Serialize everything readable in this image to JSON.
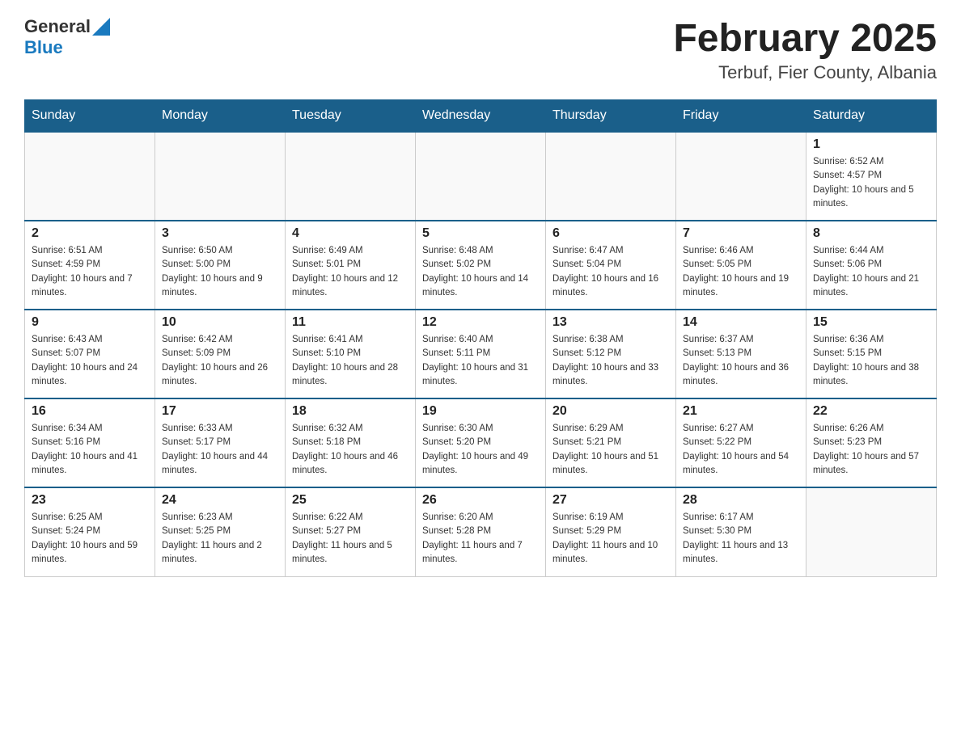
{
  "header": {
    "logo_general": "General",
    "logo_blue": "Blue",
    "month_title": "February 2025",
    "location": "Terbuf, Fier County, Albania"
  },
  "weekdays": [
    "Sunday",
    "Monday",
    "Tuesday",
    "Wednesday",
    "Thursday",
    "Friday",
    "Saturday"
  ],
  "weeks": [
    [
      {
        "day": "",
        "info": ""
      },
      {
        "day": "",
        "info": ""
      },
      {
        "day": "",
        "info": ""
      },
      {
        "day": "",
        "info": ""
      },
      {
        "day": "",
        "info": ""
      },
      {
        "day": "",
        "info": ""
      },
      {
        "day": "1",
        "info": "Sunrise: 6:52 AM\nSunset: 4:57 PM\nDaylight: 10 hours and 5 minutes."
      }
    ],
    [
      {
        "day": "2",
        "info": "Sunrise: 6:51 AM\nSunset: 4:59 PM\nDaylight: 10 hours and 7 minutes."
      },
      {
        "day": "3",
        "info": "Sunrise: 6:50 AM\nSunset: 5:00 PM\nDaylight: 10 hours and 9 minutes."
      },
      {
        "day": "4",
        "info": "Sunrise: 6:49 AM\nSunset: 5:01 PM\nDaylight: 10 hours and 12 minutes."
      },
      {
        "day": "5",
        "info": "Sunrise: 6:48 AM\nSunset: 5:02 PM\nDaylight: 10 hours and 14 minutes."
      },
      {
        "day": "6",
        "info": "Sunrise: 6:47 AM\nSunset: 5:04 PM\nDaylight: 10 hours and 16 minutes."
      },
      {
        "day": "7",
        "info": "Sunrise: 6:46 AM\nSunset: 5:05 PM\nDaylight: 10 hours and 19 minutes."
      },
      {
        "day": "8",
        "info": "Sunrise: 6:44 AM\nSunset: 5:06 PM\nDaylight: 10 hours and 21 minutes."
      }
    ],
    [
      {
        "day": "9",
        "info": "Sunrise: 6:43 AM\nSunset: 5:07 PM\nDaylight: 10 hours and 24 minutes."
      },
      {
        "day": "10",
        "info": "Sunrise: 6:42 AM\nSunset: 5:09 PM\nDaylight: 10 hours and 26 minutes."
      },
      {
        "day": "11",
        "info": "Sunrise: 6:41 AM\nSunset: 5:10 PM\nDaylight: 10 hours and 28 minutes."
      },
      {
        "day": "12",
        "info": "Sunrise: 6:40 AM\nSunset: 5:11 PM\nDaylight: 10 hours and 31 minutes."
      },
      {
        "day": "13",
        "info": "Sunrise: 6:38 AM\nSunset: 5:12 PM\nDaylight: 10 hours and 33 minutes."
      },
      {
        "day": "14",
        "info": "Sunrise: 6:37 AM\nSunset: 5:13 PM\nDaylight: 10 hours and 36 minutes."
      },
      {
        "day": "15",
        "info": "Sunrise: 6:36 AM\nSunset: 5:15 PM\nDaylight: 10 hours and 38 minutes."
      }
    ],
    [
      {
        "day": "16",
        "info": "Sunrise: 6:34 AM\nSunset: 5:16 PM\nDaylight: 10 hours and 41 minutes."
      },
      {
        "day": "17",
        "info": "Sunrise: 6:33 AM\nSunset: 5:17 PM\nDaylight: 10 hours and 44 minutes."
      },
      {
        "day": "18",
        "info": "Sunrise: 6:32 AM\nSunset: 5:18 PM\nDaylight: 10 hours and 46 minutes."
      },
      {
        "day": "19",
        "info": "Sunrise: 6:30 AM\nSunset: 5:20 PM\nDaylight: 10 hours and 49 minutes."
      },
      {
        "day": "20",
        "info": "Sunrise: 6:29 AM\nSunset: 5:21 PM\nDaylight: 10 hours and 51 minutes."
      },
      {
        "day": "21",
        "info": "Sunrise: 6:27 AM\nSunset: 5:22 PM\nDaylight: 10 hours and 54 minutes."
      },
      {
        "day": "22",
        "info": "Sunrise: 6:26 AM\nSunset: 5:23 PM\nDaylight: 10 hours and 57 minutes."
      }
    ],
    [
      {
        "day": "23",
        "info": "Sunrise: 6:25 AM\nSunset: 5:24 PM\nDaylight: 10 hours and 59 minutes."
      },
      {
        "day": "24",
        "info": "Sunrise: 6:23 AM\nSunset: 5:25 PM\nDaylight: 11 hours and 2 minutes."
      },
      {
        "day": "25",
        "info": "Sunrise: 6:22 AM\nSunset: 5:27 PM\nDaylight: 11 hours and 5 minutes."
      },
      {
        "day": "26",
        "info": "Sunrise: 6:20 AM\nSunset: 5:28 PM\nDaylight: 11 hours and 7 minutes."
      },
      {
        "day": "27",
        "info": "Sunrise: 6:19 AM\nSunset: 5:29 PM\nDaylight: 11 hours and 10 minutes."
      },
      {
        "day": "28",
        "info": "Sunrise: 6:17 AM\nSunset: 5:30 PM\nDaylight: 11 hours and 13 minutes."
      },
      {
        "day": "",
        "info": ""
      }
    ]
  ]
}
